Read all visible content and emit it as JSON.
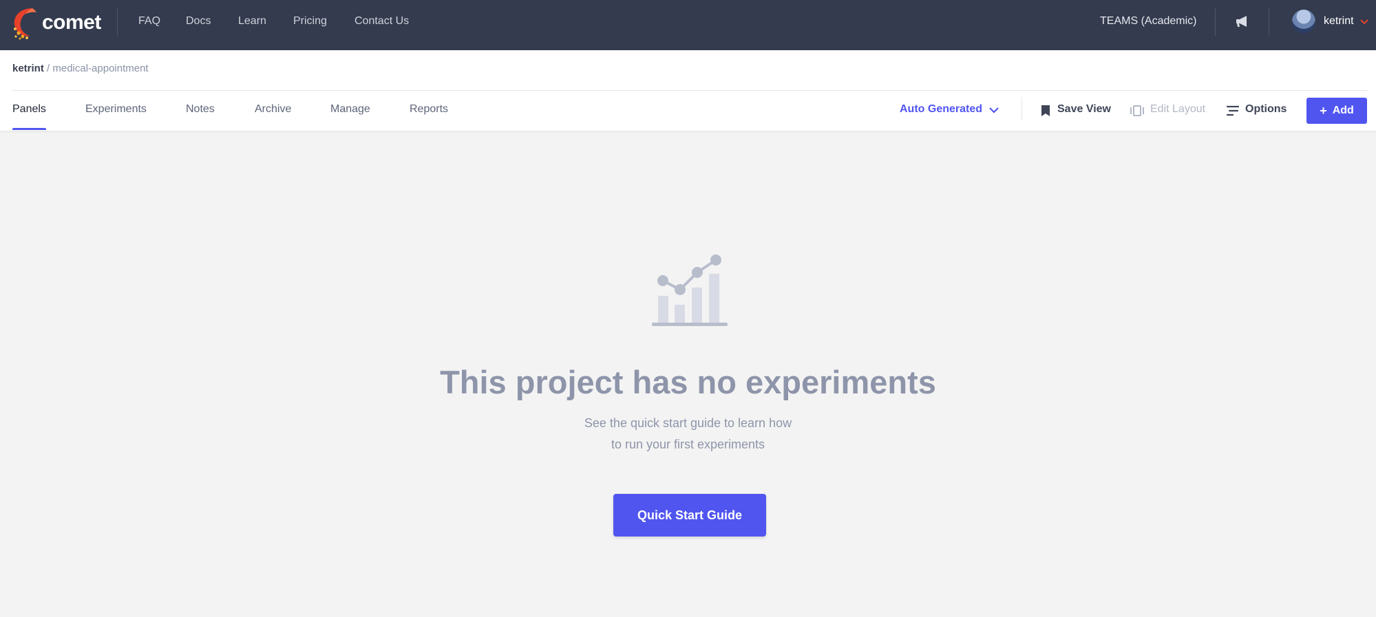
{
  "topbar": {
    "brand": "comet",
    "nav": [
      "FAQ",
      "Docs",
      "Learn",
      "Pricing",
      "Contact Us"
    ],
    "plan": "TEAMS (Academic)",
    "username": "ketrint"
  },
  "breadcrumb": {
    "owner": "ketrint",
    "separator": "/",
    "project": "medical-appointment"
  },
  "tabs": [
    "Panels",
    "Experiments",
    "Notes",
    "Archive",
    "Manage",
    "Reports"
  ],
  "active_tab": "Panels",
  "toolbar": {
    "view_select": "Auto Generated",
    "save_view": "Save View",
    "edit_layout": "Edit Layout",
    "options": "Options",
    "add": "Add"
  },
  "empty_state": {
    "title": "This project has no experiments",
    "subtitle_line1": "See the quick start guide to learn how",
    "subtitle_line2": "to run your first experiments",
    "button": "Quick Start Guide"
  },
  "colors": {
    "topbar_bg": "#343b4e",
    "accent": "#5055f0",
    "muted_text": "#8e95aa",
    "page_bg": "#f3f3f3"
  },
  "icons": [
    "comet-logo-icon",
    "megaphone-icon",
    "chevron-down-icon",
    "bookmark-icon",
    "layout-icon",
    "options-lines-icon",
    "plus-icon",
    "chart-illustration-icon"
  ]
}
